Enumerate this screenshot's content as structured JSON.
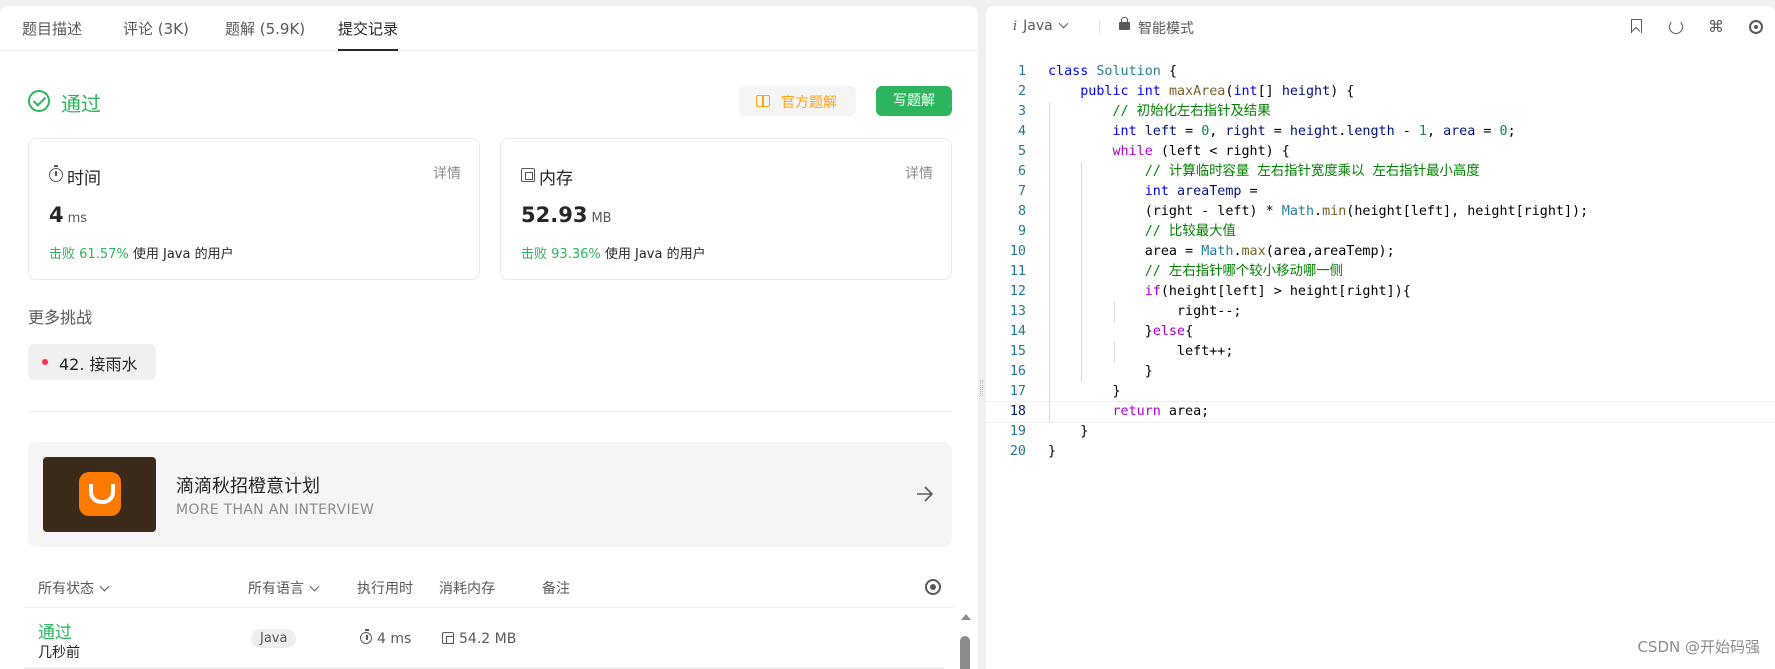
{
  "tabs": [
    {
      "label": "题目描述"
    },
    {
      "label": "评论 (3K)"
    },
    {
      "label": "题解 (5.9K)"
    },
    {
      "label": "提交记录"
    }
  ],
  "result": {
    "status": "通过",
    "official_solution_label": "官方题解",
    "write_solution_label": "写题解"
  },
  "time_card": {
    "title": "时间",
    "detail": "详情",
    "value": "4",
    "unit": "ms",
    "beat_prefix": "击败",
    "beat_pct": "61.57%",
    "beat_suffix": "使用 Java 的用户"
  },
  "memory_card": {
    "title": "内存",
    "detail": "详情",
    "value": "52.93",
    "unit": "MB",
    "beat_prefix": "击败",
    "beat_pct": "93.36%",
    "beat_suffix": "使用 Java 的用户"
  },
  "more": {
    "title": "更多挑战",
    "challenge": "42. 接雨水"
  },
  "banner": {
    "title": "滴滴秋招橙意计划",
    "subtitle": "MORE THAN AN INTERVIEW"
  },
  "list": {
    "headers": {
      "status": "所有状态",
      "language": "所有语言",
      "runtime": "执行用时",
      "memory": "消耗内存",
      "notes": "备注"
    },
    "rows": [
      {
        "status": "通过",
        "time": "几秒前",
        "language": "Java",
        "runtime": "4 ms",
        "memory": "54.2 MB"
      }
    ]
  },
  "editor": {
    "language": "Java",
    "mode": "智能模式",
    "current_line": 18
  },
  "code": [
    {
      "n": "1",
      "html": "<span class=\"kw\">class</span> <span class=\"cls\">Solution</span> {"
    },
    {
      "n": "2",
      "html": "    <span class=\"kw\">public</span> <span class=\"kw\">int</span> <span class=\"fn\">maxArea</span>(<span class=\"kw\">int</span>[] <span class=\"var\">height</span>) {"
    },
    {
      "n": "3",
      "html": "        <span class=\"cm\">// 初始化左右指针及结果</span>"
    },
    {
      "n": "4",
      "html": "        <span class=\"kw\">int</span> <span class=\"var\">left</span> = <span class=\"num\">0</span>, <span class=\"var\">right</span> = <span class=\"var\">height</span>.<span class=\"var\">length</span> - <span class=\"num\">1</span>, <span class=\"var\">area</span> = <span class=\"num\">0</span>;"
    },
    {
      "n": "5",
      "html": "        <span class=\"ctl\">while</span> (left &lt; right) {"
    },
    {
      "n": "6",
      "html": "            <span class=\"cm\">// 计算临时容量 左右指针宽度乘以 左右指针最小高度</span>"
    },
    {
      "n": "7",
      "html": "            <span class=\"kw\">int</span> <span class=\"var\">areaTemp</span> ="
    },
    {
      "n": "8",
      "html": "            (right - left) * <span class=\"cls\">Math</span>.<span class=\"fn\">min</span>(height[left], height[right]);"
    },
    {
      "n": "9",
      "html": "            <span class=\"cm\">// 比较最大值</span>"
    },
    {
      "n": "10",
      "html": "            area = <span class=\"cls\">Math</span>.<span class=\"fn\">max</span>(area,areaTemp);"
    },
    {
      "n": "11",
      "html": "            <span class=\"cm\">// 左右指针哪个较小移动哪一侧</span>"
    },
    {
      "n": "12",
      "html": "            <span class=\"ctl\">if</span>(height[left] &gt; height[right]){"
    },
    {
      "n": "13",
      "html": "                right--;"
    },
    {
      "n": "14",
      "html": "            }<span class=\"ctl\">else</span>{"
    },
    {
      "n": "15",
      "html": "                left++;"
    },
    {
      "n": "16",
      "html": "            }"
    },
    {
      "n": "17",
      "html": "        }"
    },
    {
      "n": "18",
      "html": "        <span class=\"ctl\">return</span> area;"
    },
    {
      "n": "19",
      "html": "    }"
    },
    {
      "n": "20",
      "html": "}"
    }
  ],
  "watermark": "CSDN @开始码强",
  "colors": {
    "accent_green": "#2db55d",
    "accent_orange": "#ffa116"
  }
}
